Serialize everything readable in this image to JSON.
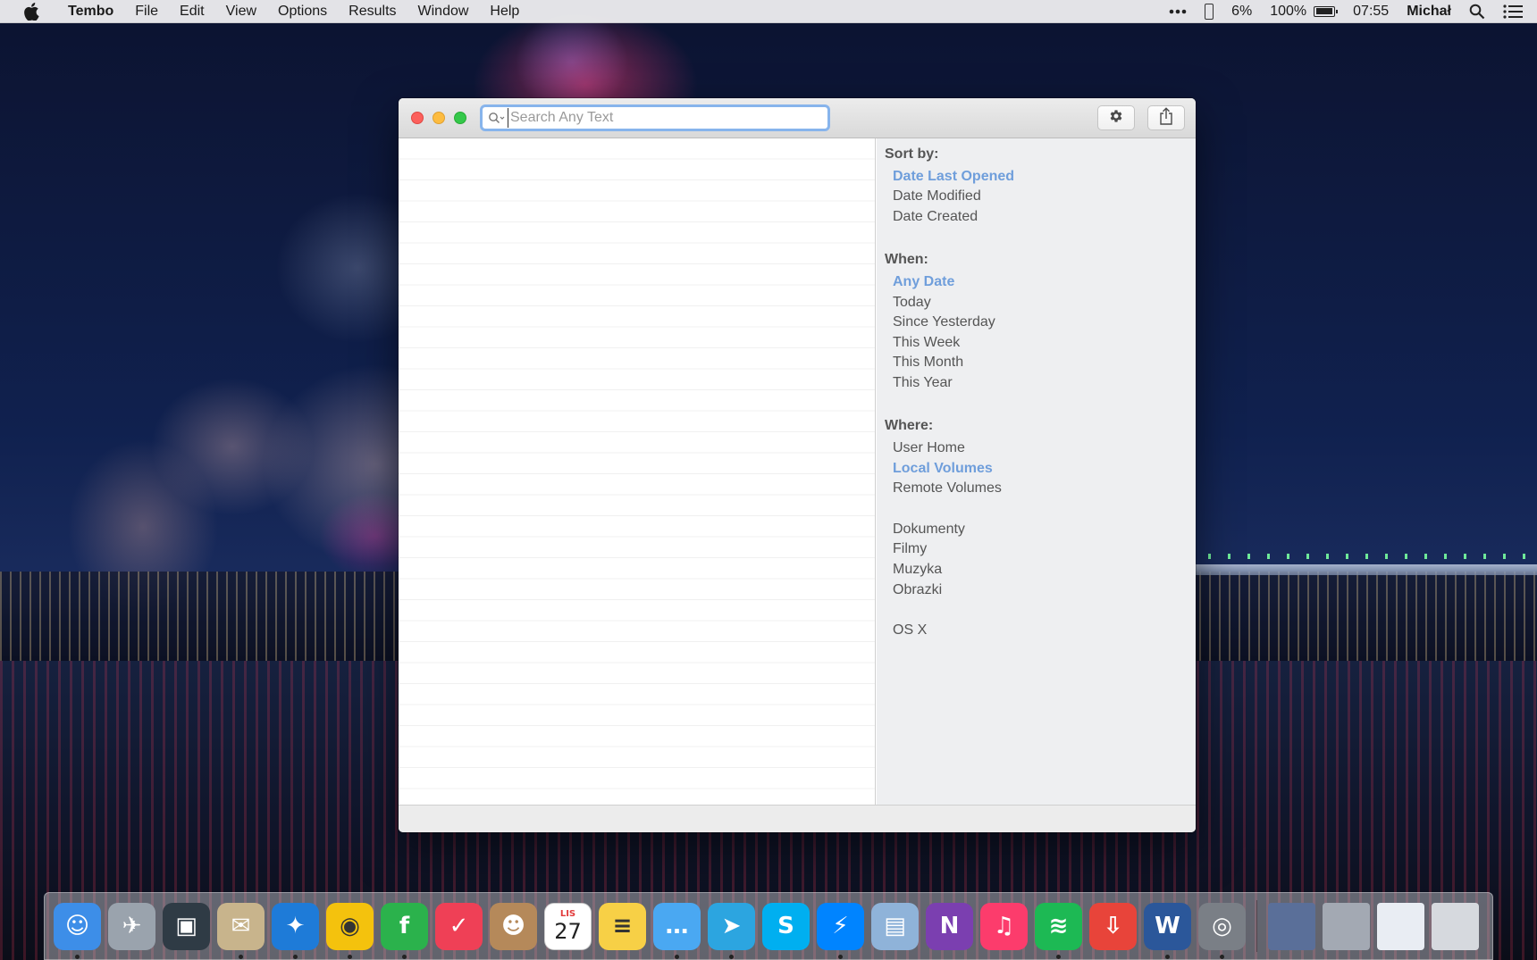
{
  "menubar": {
    "app_name": "Tembo",
    "menus": [
      "File",
      "Edit",
      "View",
      "Options",
      "Results",
      "Window",
      "Help"
    ],
    "status": {
      "phone_battery": "6%",
      "battery": "100%",
      "battery_level": 1.0,
      "clock": "07:55",
      "user": "Michał"
    }
  },
  "window": {
    "search": {
      "placeholder": "Search Any Text",
      "value": ""
    },
    "sidebar": {
      "sort_by": {
        "title": "Sort by:",
        "options": [
          "Date Last Opened",
          "Date Modified",
          "Date Created"
        ],
        "selected": "Date Last Opened"
      },
      "when": {
        "title": "When:",
        "options": [
          "Any Date",
          "Today",
          "Since Yesterday",
          "This Week",
          "This Month",
          "This Year"
        ],
        "selected": "Any Date"
      },
      "where": {
        "title": "Where:",
        "options": [
          "User Home",
          "Local Volumes",
          "Remote Volumes"
        ],
        "selected": "Local Volumes",
        "folders": [
          "Dokumenty",
          "Filmy",
          "Muzyka",
          "Obrazki"
        ],
        "volumes": [
          "OS X"
        ]
      }
    }
  },
  "dock": {
    "calendar_month": "LIS",
    "calendar_day": "27",
    "items": [
      {
        "name": "finder",
        "color": "#3d8ee8",
        "running": true
      },
      {
        "name": "launchpad",
        "color": "#9aa3ad",
        "running": false
      },
      {
        "name": "photo-booth",
        "color": "#2f3b45",
        "running": false
      },
      {
        "name": "mail",
        "color": "#c8b48c",
        "running": true
      },
      {
        "name": "safari",
        "color": "#1e7bd8",
        "running": true
      },
      {
        "name": "chrome",
        "color": "#f4c20d",
        "running": true
      },
      {
        "name": "feedly",
        "color": "#2bb24c",
        "running": true
      },
      {
        "name": "pocket",
        "color": "#ef4056",
        "running": false
      },
      {
        "name": "contacts",
        "color": "#b5895a",
        "running": false
      },
      {
        "name": "calendar",
        "color": "#ffffff",
        "running": false
      },
      {
        "name": "notes",
        "color": "#f7d046",
        "running": false
      },
      {
        "name": "messages",
        "color": "#4aa8f2",
        "running": true
      },
      {
        "name": "telegram",
        "color": "#2ca5e0",
        "running": true
      },
      {
        "name": "skype",
        "color": "#00aff0",
        "running": false
      },
      {
        "name": "messenger",
        "color": "#0084ff",
        "running": true
      },
      {
        "name": "preview",
        "color": "#8fb3d9",
        "running": false
      },
      {
        "name": "onenote",
        "color": "#7b3fb0",
        "running": false
      },
      {
        "name": "itunes",
        "color": "#fc3c6c",
        "running": false
      },
      {
        "name": "spotify",
        "color": "#1db954",
        "running": true
      },
      {
        "name": "transmit",
        "color": "#e8443a",
        "running": false
      },
      {
        "name": "word",
        "color": "#2b579a",
        "running": true
      },
      {
        "name": "grab",
        "color": "#7a7f86",
        "running": true
      }
    ],
    "stacks": [
      {
        "name": "stack-photos",
        "color": "#5a6f99"
      },
      {
        "name": "stack-people",
        "color": "#a3a9b3"
      },
      {
        "name": "stack-documents",
        "color": "#e9edf3"
      },
      {
        "name": "trash",
        "color": "#d6d9de"
      }
    ]
  }
}
